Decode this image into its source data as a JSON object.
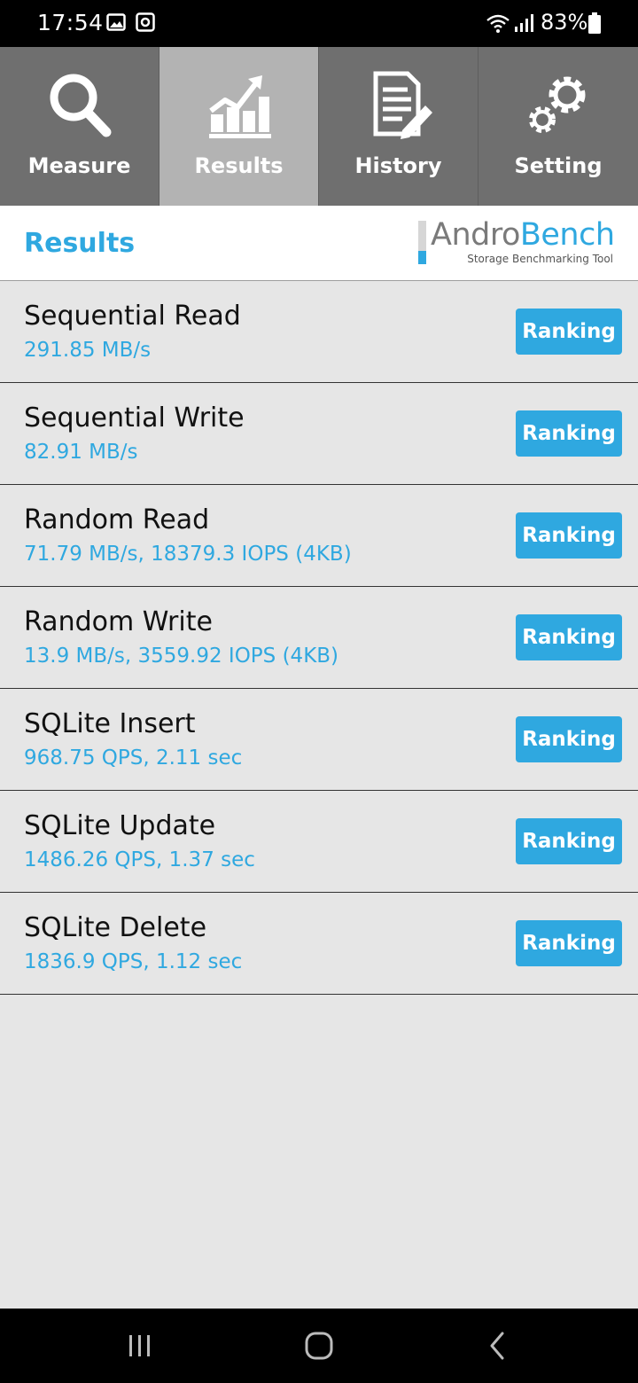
{
  "status_bar": {
    "time": "17:54",
    "battery": "83%",
    "icons": [
      "gallery-icon",
      "screen-record-icon",
      "wifi-icon",
      "signal-icon",
      "battery-icon"
    ]
  },
  "tabs": [
    {
      "label": "Measure",
      "icon": "search-icon",
      "active": false
    },
    {
      "label": "Results",
      "icon": "chart-icon",
      "active": true
    },
    {
      "label": "History",
      "icon": "document-icon",
      "active": false
    },
    {
      "label": "Setting",
      "icon": "gear-icon",
      "active": false
    }
  ],
  "header": {
    "title": "Results",
    "logo_part1": "Andro",
    "logo_part2": "Bench",
    "logo_subtitle": "Storage Benchmarking Tool"
  },
  "results": [
    {
      "title": "Sequential Read",
      "value": "291.85 MB/s",
      "button": "Ranking"
    },
    {
      "title": "Sequential Write",
      "value": "82.91 MB/s",
      "button": "Ranking"
    },
    {
      "title": "Random Read",
      "value": "71.79 MB/s, 18379.3 IOPS (4KB)",
      "button": "Ranking"
    },
    {
      "title": "Random Write",
      "value": "13.9 MB/s, 3559.92 IOPS (4KB)",
      "button": "Ranking"
    },
    {
      "title": "SQLite Insert",
      "value": "968.75 QPS, 2.11 sec",
      "button": "Ranking"
    },
    {
      "title": "SQLite Update",
      "value": "1486.26 QPS, 1.37 sec",
      "button": "Ranking"
    },
    {
      "title": "SQLite Delete",
      "value": "1836.9 QPS, 1.12 sec",
      "button": "Ranking"
    }
  ],
  "colors": {
    "accent": "#2fa8e0",
    "tab_bg": "#6f6f6f",
    "tab_active_bg": "#b3b3b3",
    "list_bg": "#e6e6e6"
  }
}
